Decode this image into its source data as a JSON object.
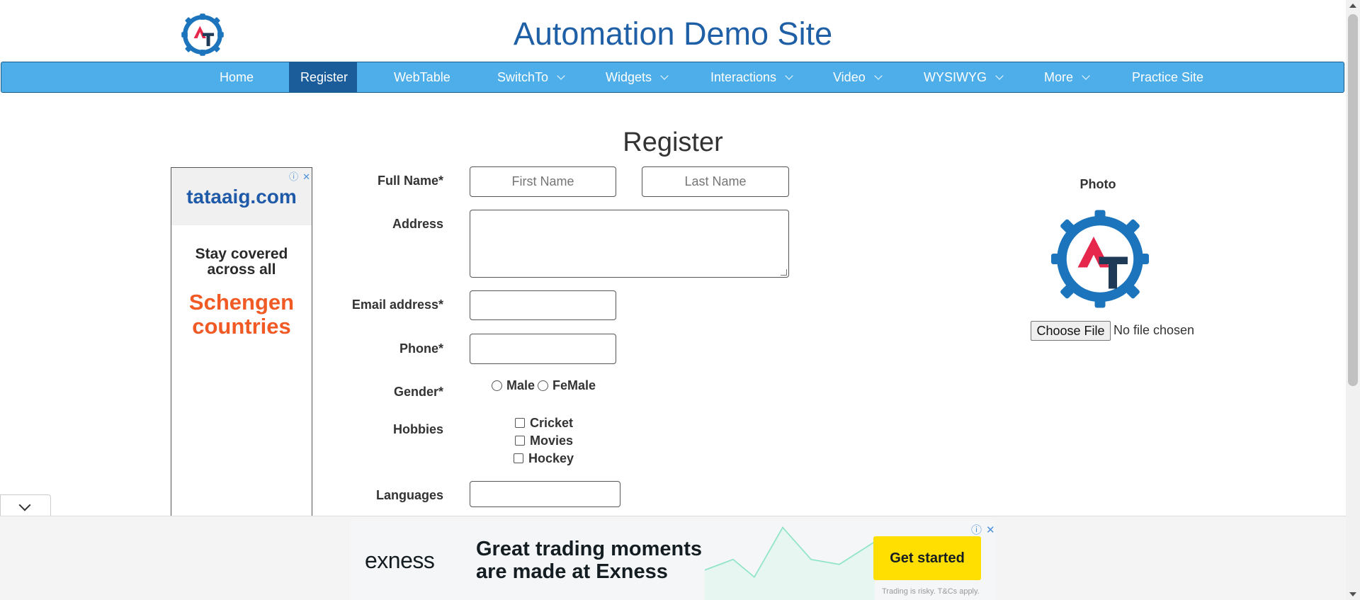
{
  "header": {
    "title": "Automation Demo Site"
  },
  "nav": {
    "items": [
      {
        "label": "Home",
        "active": false,
        "dropdown": false
      },
      {
        "label": "Register",
        "active": true,
        "dropdown": false
      },
      {
        "label": "WebTable",
        "active": false,
        "dropdown": false
      },
      {
        "label": "SwitchTo",
        "active": false,
        "dropdown": true
      },
      {
        "label": "Widgets",
        "active": false,
        "dropdown": true
      },
      {
        "label": "Interactions",
        "active": false,
        "dropdown": true
      },
      {
        "label": "Video",
        "active": false,
        "dropdown": true
      },
      {
        "label": "WYSIWYG",
        "active": false,
        "dropdown": true
      },
      {
        "label": "More",
        "active": false,
        "dropdown": true
      },
      {
        "label": "Practice Site",
        "active": false,
        "dropdown": false
      }
    ]
  },
  "page_heading": "Register",
  "side_ad": {
    "brand": "tataaig.com",
    "line1": "Stay covered across all",
    "line2": "Schengen countries"
  },
  "form": {
    "full_name_label": "Full Name*",
    "first_name_placeholder": "First Name",
    "last_name_placeholder": "Last Name",
    "address_label": "Address",
    "email_label": "Email address*",
    "phone_label": "Phone*",
    "gender_label": "Gender*",
    "gender_options": [
      "Male",
      "FeMale"
    ],
    "hobbies_label": "Hobbies",
    "hobbies": [
      "Cricket",
      "Movies",
      "Hockey"
    ],
    "languages_label": "Languages"
  },
  "photo": {
    "label": "Photo",
    "button": "Choose File",
    "status": "No file chosen"
  },
  "bottom_ad": {
    "brand": "exness",
    "tagline_1": "Great trading moments",
    "tagline_2": "are made at Exness",
    "cta": "Get started",
    "risk": "Trading is risky. T&Cs apply."
  },
  "colors": {
    "nav_bg": "#4daee9",
    "nav_active": "#1a5d9a",
    "title": "#1f5fa6",
    "cta": "#ffde02"
  }
}
